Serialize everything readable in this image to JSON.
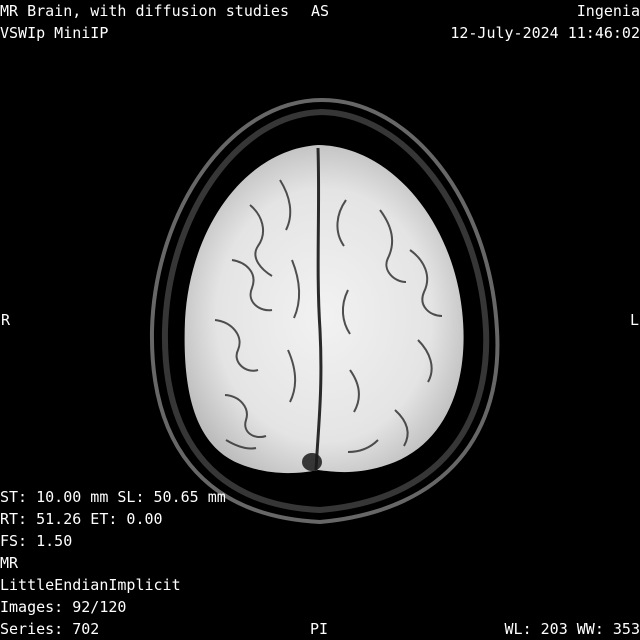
{
  "overlay": {
    "top_left": {
      "study_description": "MR Brain, with diffusion studies",
      "series_description": "VSWIp MiniIP"
    },
    "top_right": {
      "institution": "Ingenia",
      "datetime": "12-July-2024 11:46:02"
    },
    "bottom_left": {
      "thickness_location": "ST: 10.00 mm SL: 50.65 mm",
      "timing": "RT: 51.26 ET: 0.00",
      "field_strength": "FS: 1.50",
      "modality": "MR",
      "transfer_syntax": "LittleEndianImplicit",
      "images": "Images: 92/120",
      "series": "Series: 702"
    },
    "bottom_right": {
      "window": "WL: 203 WW: 353"
    },
    "orientation": {
      "top": "AS",
      "left": "R",
      "right": "L",
      "bottom": "PI"
    }
  },
  "image": {
    "background_color": "#000000",
    "text_color": "#ffffff"
  }
}
